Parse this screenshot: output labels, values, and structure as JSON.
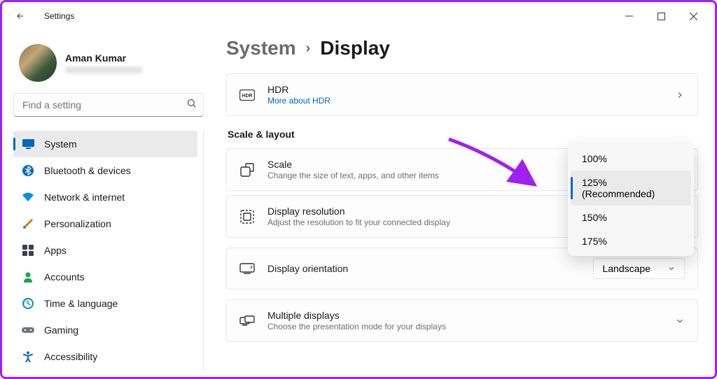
{
  "window": {
    "title": "Settings"
  },
  "profile": {
    "name": "Aman Kumar"
  },
  "search": {
    "placeholder": "Find a setting"
  },
  "sidebar": {
    "items": [
      {
        "label": "System",
        "active": true
      },
      {
        "label": "Bluetooth & devices"
      },
      {
        "label": "Network & internet"
      },
      {
        "label": "Personalization"
      },
      {
        "label": "Apps"
      },
      {
        "label": "Accounts"
      },
      {
        "label": "Time & language"
      },
      {
        "label": "Gaming"
      },
      {
        "label": "Accessibility"
      }
    ]
  },
  "breadcrumb": {
    "parent": "System",
    "current": "Display"
  },
  "cards": {
    "hdr": {
      "title": "HDR",
      "link": "More about HDR"
    },
    "scale": {
      "title": "Scale",
      "sub": "Change the size of text, apps, and other items"
    },
    "resolution": {
      "title": "Display resolution",
      "sub": "Adjust the resolution to fit your connected display"
    },
    "orientation": {
      "title": "Display orientation",
      "value": "Landscape"
    },
    "multiple": {
      "title": "Multiple displays",
      "sub": "Choose the presentation mode for your displays"
    }
  },
  "section": {
    "scale_layout": "Scale & layout"
  },
  "scale_dropdown": {
    "options": [
      "100%",
      "125% (Recommended)",
      "150%",
      "175%"
    ],
    "selected_index": 1
  }
}
